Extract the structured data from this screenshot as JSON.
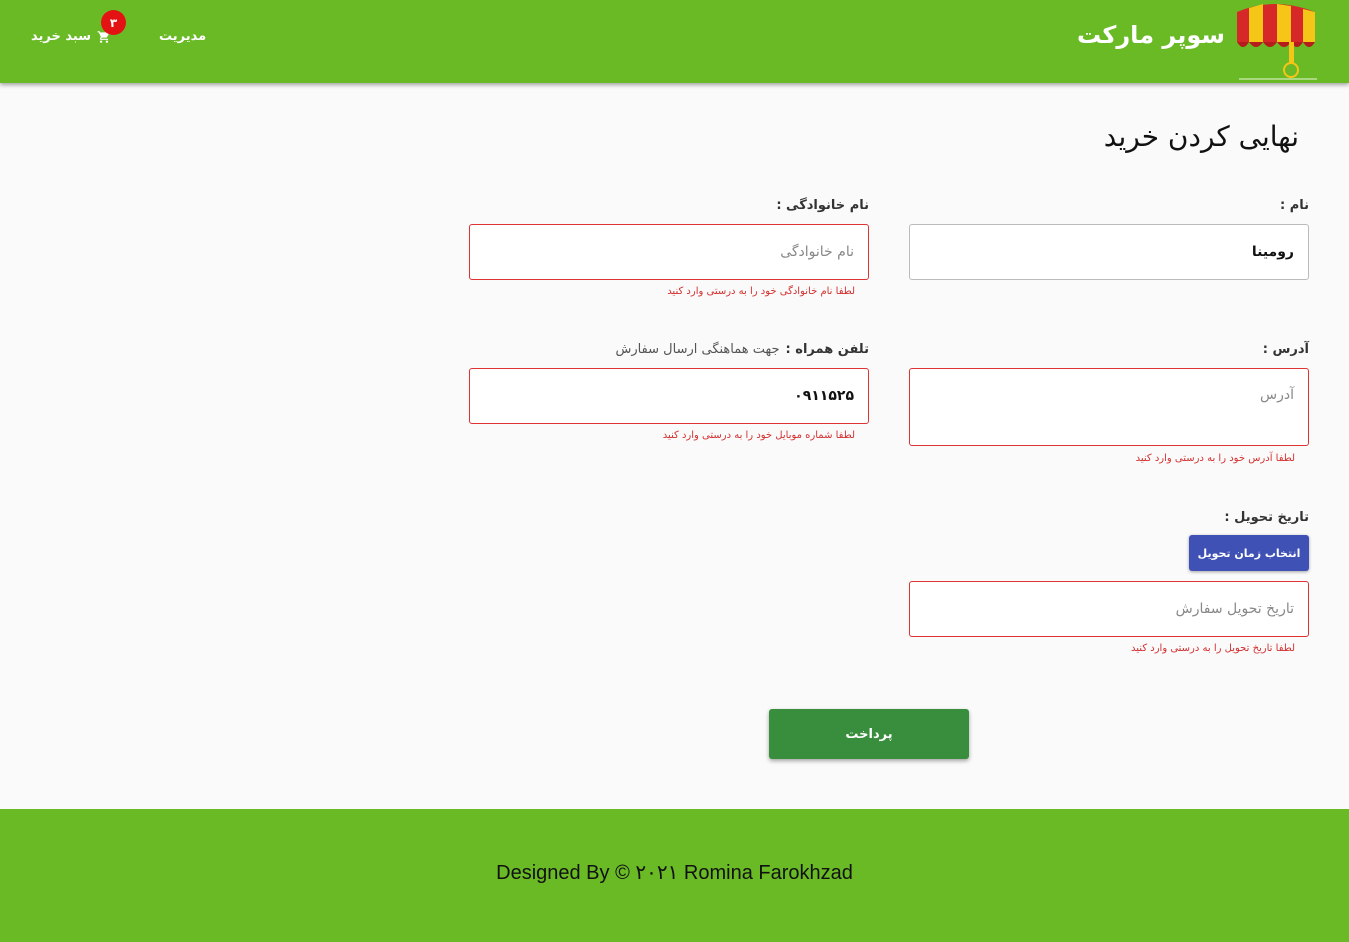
{
  "header": {
    "brand_name": "سوپر مارکت",
    "nav_admin": "مدیریت",
    "nav_cart": "سبد خرید",
    "cart_count": "۳",
    "colors": {
      "bar": "#6aba26",
      "badge": "#e31313"
    }
  },
  "page": {
    "title": "نهایی کردن خرید"
  },
  "form": {
    "first_name": {
      "label": "نام :",
      "value": "رومینا"
    },
    "last_name": {
      "label": "نام خانوادگی :",
      "placeholder": "نام خانوادگی",
      "error": "لطفا نام خانوادگی خود را به درستی وارد کنید"
    },
    "address": {
      "label": "آدرس :",
      "placeholder": "آدرس",
      "error": "لطفا آدرس خود را به درستی وارد کنید"
    },
    "phone": {
      "label": "تلفن همراه :",
      "hint": "جهت هماهنگی ارسال سفارش",
      "value": "۰۹۱۱۵۲۵",
      "error": "لطفا شماره موبایل خود را به درستی وارد کنید"
    },
    "delivery": {
      "label": "تاریخ تحویل :",
      "button": "انتخاب زمان تحویل",
      "placeholder": "تاریخ تحویل سفارش",
      "error": "لطفا تاریخ تحویل را به درستی وارد کنید"
    },
    "pay_button": "پرداخت",
    "colors": {
      "error": "#d32f2f",
      "date_button": "#3f51b5",
      "pay_button": "#388e3c"
    }
  },
  "footer": {
    "text": "Designed By © ۲۰۲۱ Romina Farokhzad"
  }
}
